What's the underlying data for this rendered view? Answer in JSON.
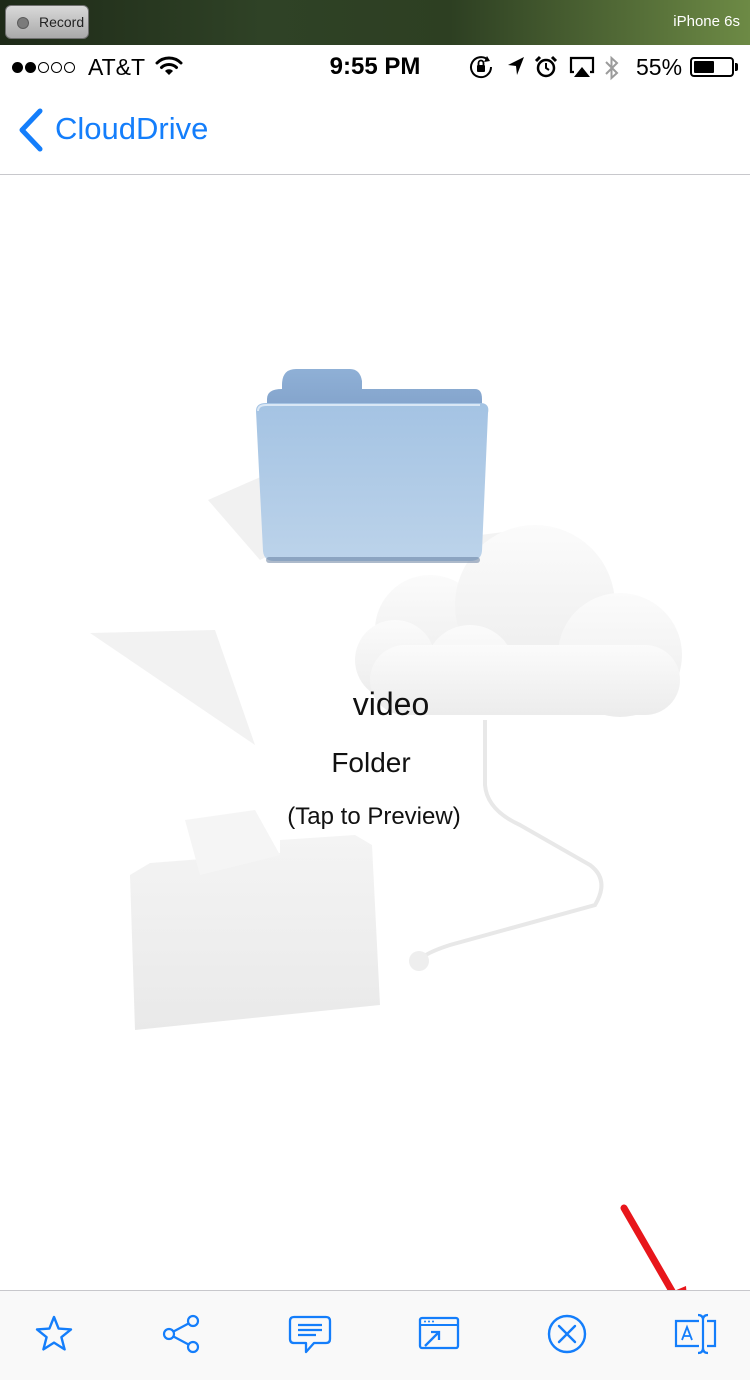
{
  "recording": {
    "button_label": "Record",
    "device": "iPhone 6s"
  },
  "status_bar": {
    "carrier": "AT&T",
    "time": "9:55 PM",
    "battery_percent": "55%",
    "battery_level": 0.55,
    "signal_bars_filled": 2,
    "signal_bars_total": 5,
    "icons": [
      "wifi-icon",
      "rotation-lock-icon",
      "location-icon",
      "alarm-icon",
      "airplay-icon",
      "bluetooth-icon",
      "battery-icon"
    ]
  },
  "nav": {
    "back_label": "CloudDrive"
  },
  "item": {
    "name": "video",
    "kind": "Folder",
    "hint": "(Tap to Preview)",
    "icon": "folder-icon"
  },
  "toolbar": {
    "buttons": [
      {
        "name": "favorite-button",
        "icon": "star-icon"
      },
      {
        "name": "share-button",
        "icon": "share-icon"
      },
      {
        "name": "comment-button",
        "icon": "comment-icon"
      },
      {
        "name": "open-in-button",
        "icon": "open-in-window-icon"
      },
      {
        "name": "close-button",
        "icon": "close-circle-icon"
      },
      {
        "name": "rename-button",
        "icon": "rename-text-icon"
      }
    ]
  },
  "colors": {
    "accent": "#147efb",
    "annotation_arrow": "#e8161b"
  }
}
